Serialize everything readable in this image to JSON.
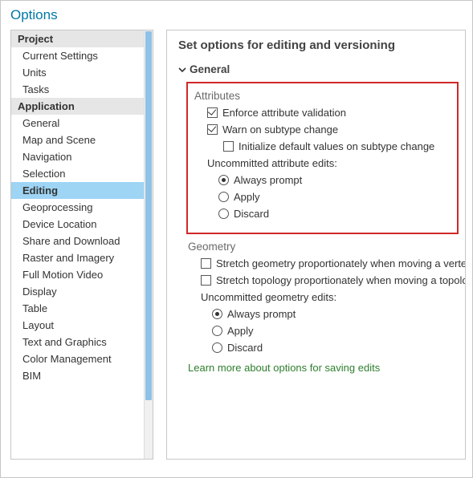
{
  "title": "Options",
  "sidebar": {
    "groups": [
      {
        "header": "Project",
        "items": [
          "Current Settings",
          "Units",
          "Tasks"
        ]
      },
      {
        "header": "Application",
        "items": [
          "General",
          "Map and Scene",
          "Navigation",
          "Selection",
          "Editing",
          "Geoprocessing",
          "Device Location",
          "Share and Download",
          "Raster and Imagery",
          "Full Motion Video",
          "Display",
          "Table",
          "Layout",
          "Text and Graphics",
          "Color Management",
          "BIM"
        ]
      }
    ],
    "selected": "Editing"
  },
  "panel": {
    "heading": "Set options for editing and versioning",
    "expander": "General",
    "attributes": {
      "title": "Attributes",
      "enforce": "Enforce attribute validation",
      "warn": "Warn on subtype change",
      "init": "Initialize default values on subtype change",
      "uncommitted": "Uncommitted attribute edits:",
      "opt_always": "Always prompt",
      "opt_apply": "Apply",
      "opt_discard": "Discard"
    },
    "geometry": {
      "title": "Geometry",
      "stretch_geom": "Stretch geometry proportionately when moving a vertex",
      "stretch_topo": "Stretch topology proportionately when moving a topology eleme",
      "uncommitted": "Uncommitted geometry edits:",
      "opt_always": "Always prompt",
      "opt_apply": "Apply",
      "opt_discard": "Discard"
    },
    "link": "Learn more about options for saving edits"
  },
  "state": {
    "attr_enforce": true,
    "attr_warn": true,
    "attr_init": false,
    "attr_radio": "always",
    "geom_stretch_geom": false,
    "geom_stretch_topo": false,
    "geom_radio": "always"
  }
}
